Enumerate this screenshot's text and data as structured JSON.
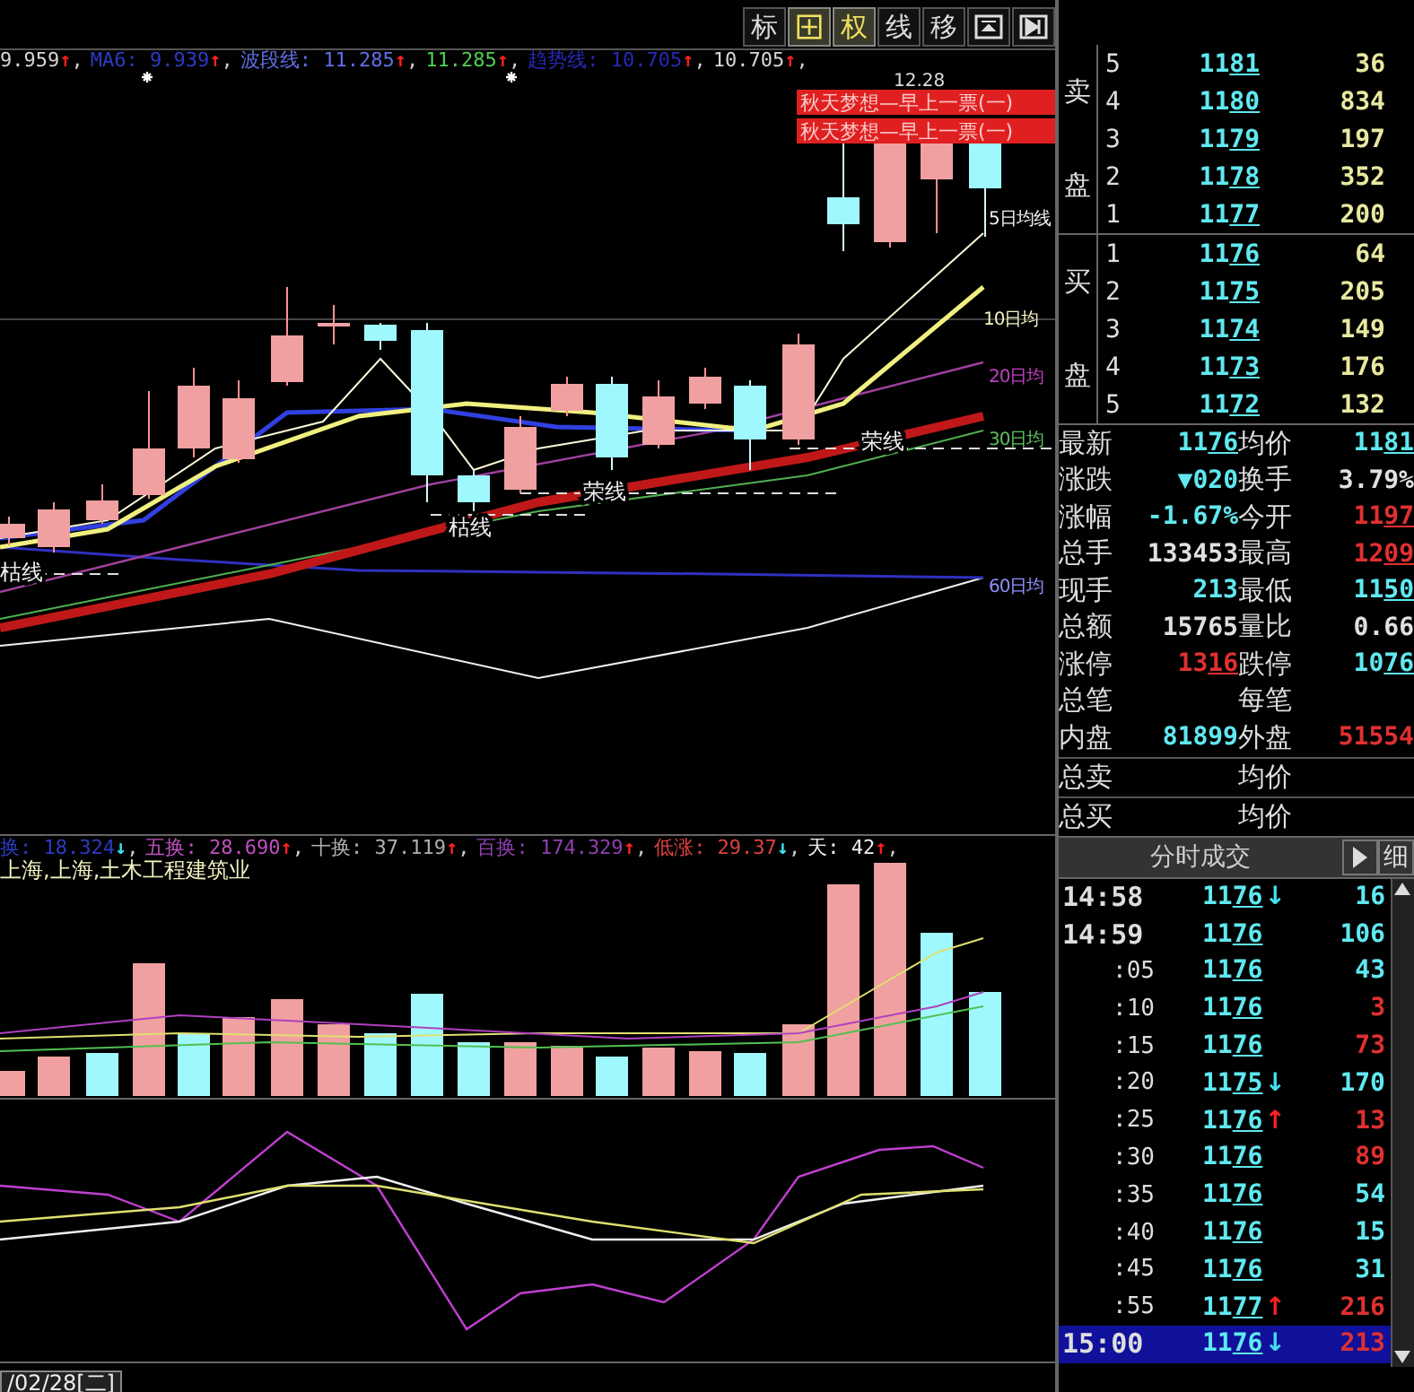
{
  "toolbar": {
    "buttons": [
      {
        "kind": "text",
        "label": "标",
        "selected": false
      },
      {
        "kind": "crosshair",
        "selected": true
      },
      {
        "kind": "text",
        "label": "权",
        "selected": true
      },
      {
        "kind": "text",
        "label": "线",
        "selected": false
      },
      {
        "kind": "text",
        "label": "移",
        "selected": false
      },
      {
        "kind": "window",
        "selected": false
      },
      {
        "kind": "next",
        "selected": false
      }
    ]
  },
  "main_legend": [
    {
      "text": "9.959",
      "color": "#d8d8d8",
      "arrow": {
        "text": "↑",
        "color": "#ff2020"
      },
      "tail": ","
    },
    {
      "text": "MA6: 9.939",
      "color": "#2b3cc4",
      "arrow": {
        "text": "↑",
        "color": "#ff2020"
      },
      "tail": ","
    },
    {
      "text": "波段线: 11.285",
      "color": "#6070e8",
      "arrow": {
        "text": "↑",
        "color": "#ff2020"
      },
      "tail": ","
    },
    {
      "text": "11.285",
      "color": "#50d050",
      "arrow": {
        "text": "↑",
        "color": "#ff2020"
      },
      "tail": ","
    },
    {
      "text": "趋势线: 10.705",
      "color": "#2828b8",
      "arrow": {
        "text": "↑",
        "color": "#ff2020"
      },
      "tail": ","
    },
    {
      "text": "10.705",
      "color": "#d8d8d8",
      "arrow": {
        "text": "↑",
        "color": "#ff2020"
      },
      "tail": ","
    }
  ],
  "main_chart": {
    "banners": [
      "秋天梦想—早上一票(一)",
      "秋天梦想—早上一票(一)"
    ],
    "price_note": "12.28",
    "ma_labels": [
      {
        "text": "5日均线",
        "color": "#f0f0f0"
      },
      {
        "text": "10日均",
        "color": "#f0f0c0"
      },
      {
        "text": "20日均",
        "color": "#c040c0"
      },
      {
        "text": "30日均",
        "color": "#60c060"
      },
      {
        "text": "60日均",
        "color": "#9090ff"
      }
    ],
    "zone_labels": [
      "荣线",
      "荣线",
      "枯线",
      "枯线"
    ]
  },
  "volume_legend": [
    {
      "text": "换: 18.324",
      "color": "#2b3cc4",
      "arrow": {
        "text": "↓",
        "color": "#40e0f0"
      },
      "tail": ","
    },
    {
      "text": "五换: 28.690",
      "color": "#c050c0",
      "arrow": {
        "text": "↑",
        "color": "#ff2020"
      },
      "tail": ","
    },
    {
      "text": "十换: 37.119",
      "color": "#b0b0b0",
      "arrow": {
        "text": "↑",
        "color": "#ff2020"
      },
      "tail": ","
    },
    {
      "text": "百换: 174.329",
      "color": "#9040b0",
      "arrow": {
        "text": "↑",
        "color": "#ff2020"
      },
      "tail": ","
    },
    {
      "text": "低涨: 29.37",
      "color": "#e04040",
      "arrow": {
        "text": "↓",
        "color": "#40e0f0"
      },
      "tail": ","
    },
    {
      "text": "天: 42",
      "color": "#f0f0f0",
      "arrow": {
        "text": "↑",
        "color": "#ff2020"
      },
      "tail": ","
    }
  ],
  "industry": "上海,上海,土木工程建筑业",
  "date_bar": "/02/28[二]",
  "order_book": {
    "sell_label": [
      "卖",
      "盘"
    ],
    "sell": [
      {
        "level": "5",
        "price": "1181",
        "volume": "36"
      },
      {
        "level": "4",
        "price": "1180",
        "volume": "834"
      },
      {
        "level": "3",
        "price": "1179",
        "volume": "197"
      },
      {
        "level": "2",
        "price": "1178",
        "volume": "352"
      },
      {
        "level": "1",
        "price": "1177",
        "volume": "200"
      }
    ],
    "buy_label": [
      "买",
      "盘"
    ],
    "buy": [
      {
        "level": "1",
        "price": "1176",
        "volume": "64"
      },
      {
        "level": "2",
        "price": "1175",
        "volume": "205"
      },
      {
        "level": "3",
        "price": "1174",
        "volume": "149"
      },
      {
        "level": "4",
        "price": "1173",
        "volume": "176"
      },
      {
        "level": "5",
        "price": "1172",
        "volume": "132"
      }
    ]
  },
  "stats": [
    {
      "label": "最新",
      "value": "1176",
      "color": "#60e8f0"
    },
    {
      "label": "均价",
      "value": "1181",
      "color": "#60e8f0"
    },
    {
      "label": "涨跌",
      "value": "▼020",
      "color": "#60e8f0"
    },
    {
      "label": "换手",
      "value": "3.79%",
      "color": "#e0e0e0"
    },
    {
      "label": "涨幅",
      "value": "-1.67%",
      "color": "#60e8f0"
    },
    {
      "label": "今开",
      "value": "1197",
      "color": "#e03030"
    },
    {
      "label": "总手",
      "value": "133453",
      "color": "#e0e0e0"
    },
    {
      "label": "最高",
      "value": "1209",
      "color": "#e03030"
    },
    {
      "label": "现手",
      "value": "213",
      "color": "#60e8f0"
    },
    {
      "label": "最低",
      "value": "1150",
      "color": "#60e8f0"
    },
    {
      "label": "总额",
      "value": "15765",
      "color": "#e0e0e0"
    },
    {
      "label": "量比",
      "value": "0.66",
      "color": "#e0e0e0"
    },
    {
      "label": "涨停",
      "value": "1316",
      "color": "#e03030"
    },
    {
      "label": "跌停",
      "value": "1076",
      "color": "#60e8f0"
    },
    {
      "label": "总笔"
    },
    {
      "label": "每笔"
    },
    {
      "label": "内盘",
      "value": "81899",
      "color": "#60e8f0"
    },
    {
      "label": "外盘",
      "value": "51554",
      "color": "#e03030"
    }
  ],
  "totals": [
    {
      "label": "总卖",
      "avg_label": "均价"
    },
    {
      "label": "总买",
      "avg_label": "均价"
    }
  ],
  "ticks": {
    "title": "分时成交",
    "detail_label": "细",
    "rows": [
      {
        "kind": "minute",
        "time": "14:58",
        "price": "1176",
        "arrow": {
          "text": "↓",
          "color": "#40e0f0"
        },
        "volume": {
          "text": "16",
          "color": "#60e8f0"
        },
        "selected": false
      },
      {
        "kind": "minute",
        "time": "14:59",
        "price": "1176",
        "volume": {
          "text": "106",
          "color": "#60e8f0"
        },
        "selected": false
      },
      {
        "kind": "second",
        "time": ":05",
        "price": "1176",
        "volume": {
          "text": "43",
          "color": "#60e8f0"
        },
        "selected": false
      },
      {
        "kind": "second",
        "time": ":10",
        "price": "1176",
        "volume": {
          "text": "3",
          "color": "#e03030"
        },
        "selected": false
      },
      {
        "kind": "second",
        "time": ":15",
        "price": "1176",
        "volume": {
          "text": "73",
          "color": "#e03030"
        },
        "selected": false
      },
      {
        "kind": "second",
        "time": ":20",
        "price": "1175",
        "arrow": {
          "text": "↓",
          "color": "#40e0f0"
        },
        "volume": {
          "text": "170",
          "color": "#60e8f0"
        },
        "selected": false
      },
      {
        "kind": "second",
        "time": ":25",
        "price": "1176",
        "arrow": {
          "text": "↑",
          "color": "#ff2020"
        },
        "volume": {
          "text": "13",
          "color": "#e03030"
        },
        "selected": false
      },
      {
        "kind": "second",
        "time": ":30",
        "price": "1176",
        "volume": {
          "text": "89",
          "color": "#e03030"
        },
        "selected": false
      },
      {
        "kind": "second",
        "time": ":35",
        "price": "1176",
        "volume": {
          "text": "54",
          "color": "#60e8f0"
        },
        "selected": false
      },
      {
        "kind": "second",
        "time": ":40",
        "price": "1176",
        "volume": {
          "text": "15",
          "color": "#60e8f0"
        },
        "selected": false
      },
      {
        "kind": "second",
        "time": ":45",
        "price": "1176",
        "volume": {
          "text": "31",
          "color": "#60e8f0"
        },
        "selected": false
      },
      {
        "kind": "second",
        "time": ":55",
        "price": "1177",
        "arrow": {
          "text": "↑",
          "color": "#ff2020"
        },
        "volume": {
          "text": "216",
          "color": "#e03030"
        },
        "selected": false
      },
      {
        "kind": "minute",
        "time": "15:00",
        "price": "1176",
        "arrow": {
          "text": "↓",
          "color": "#40e0f0"
        },
        "volume": {
          "text": "213",
          "color": "#e03030"
        },
        "selected": true
      }
    ]
  }
}
